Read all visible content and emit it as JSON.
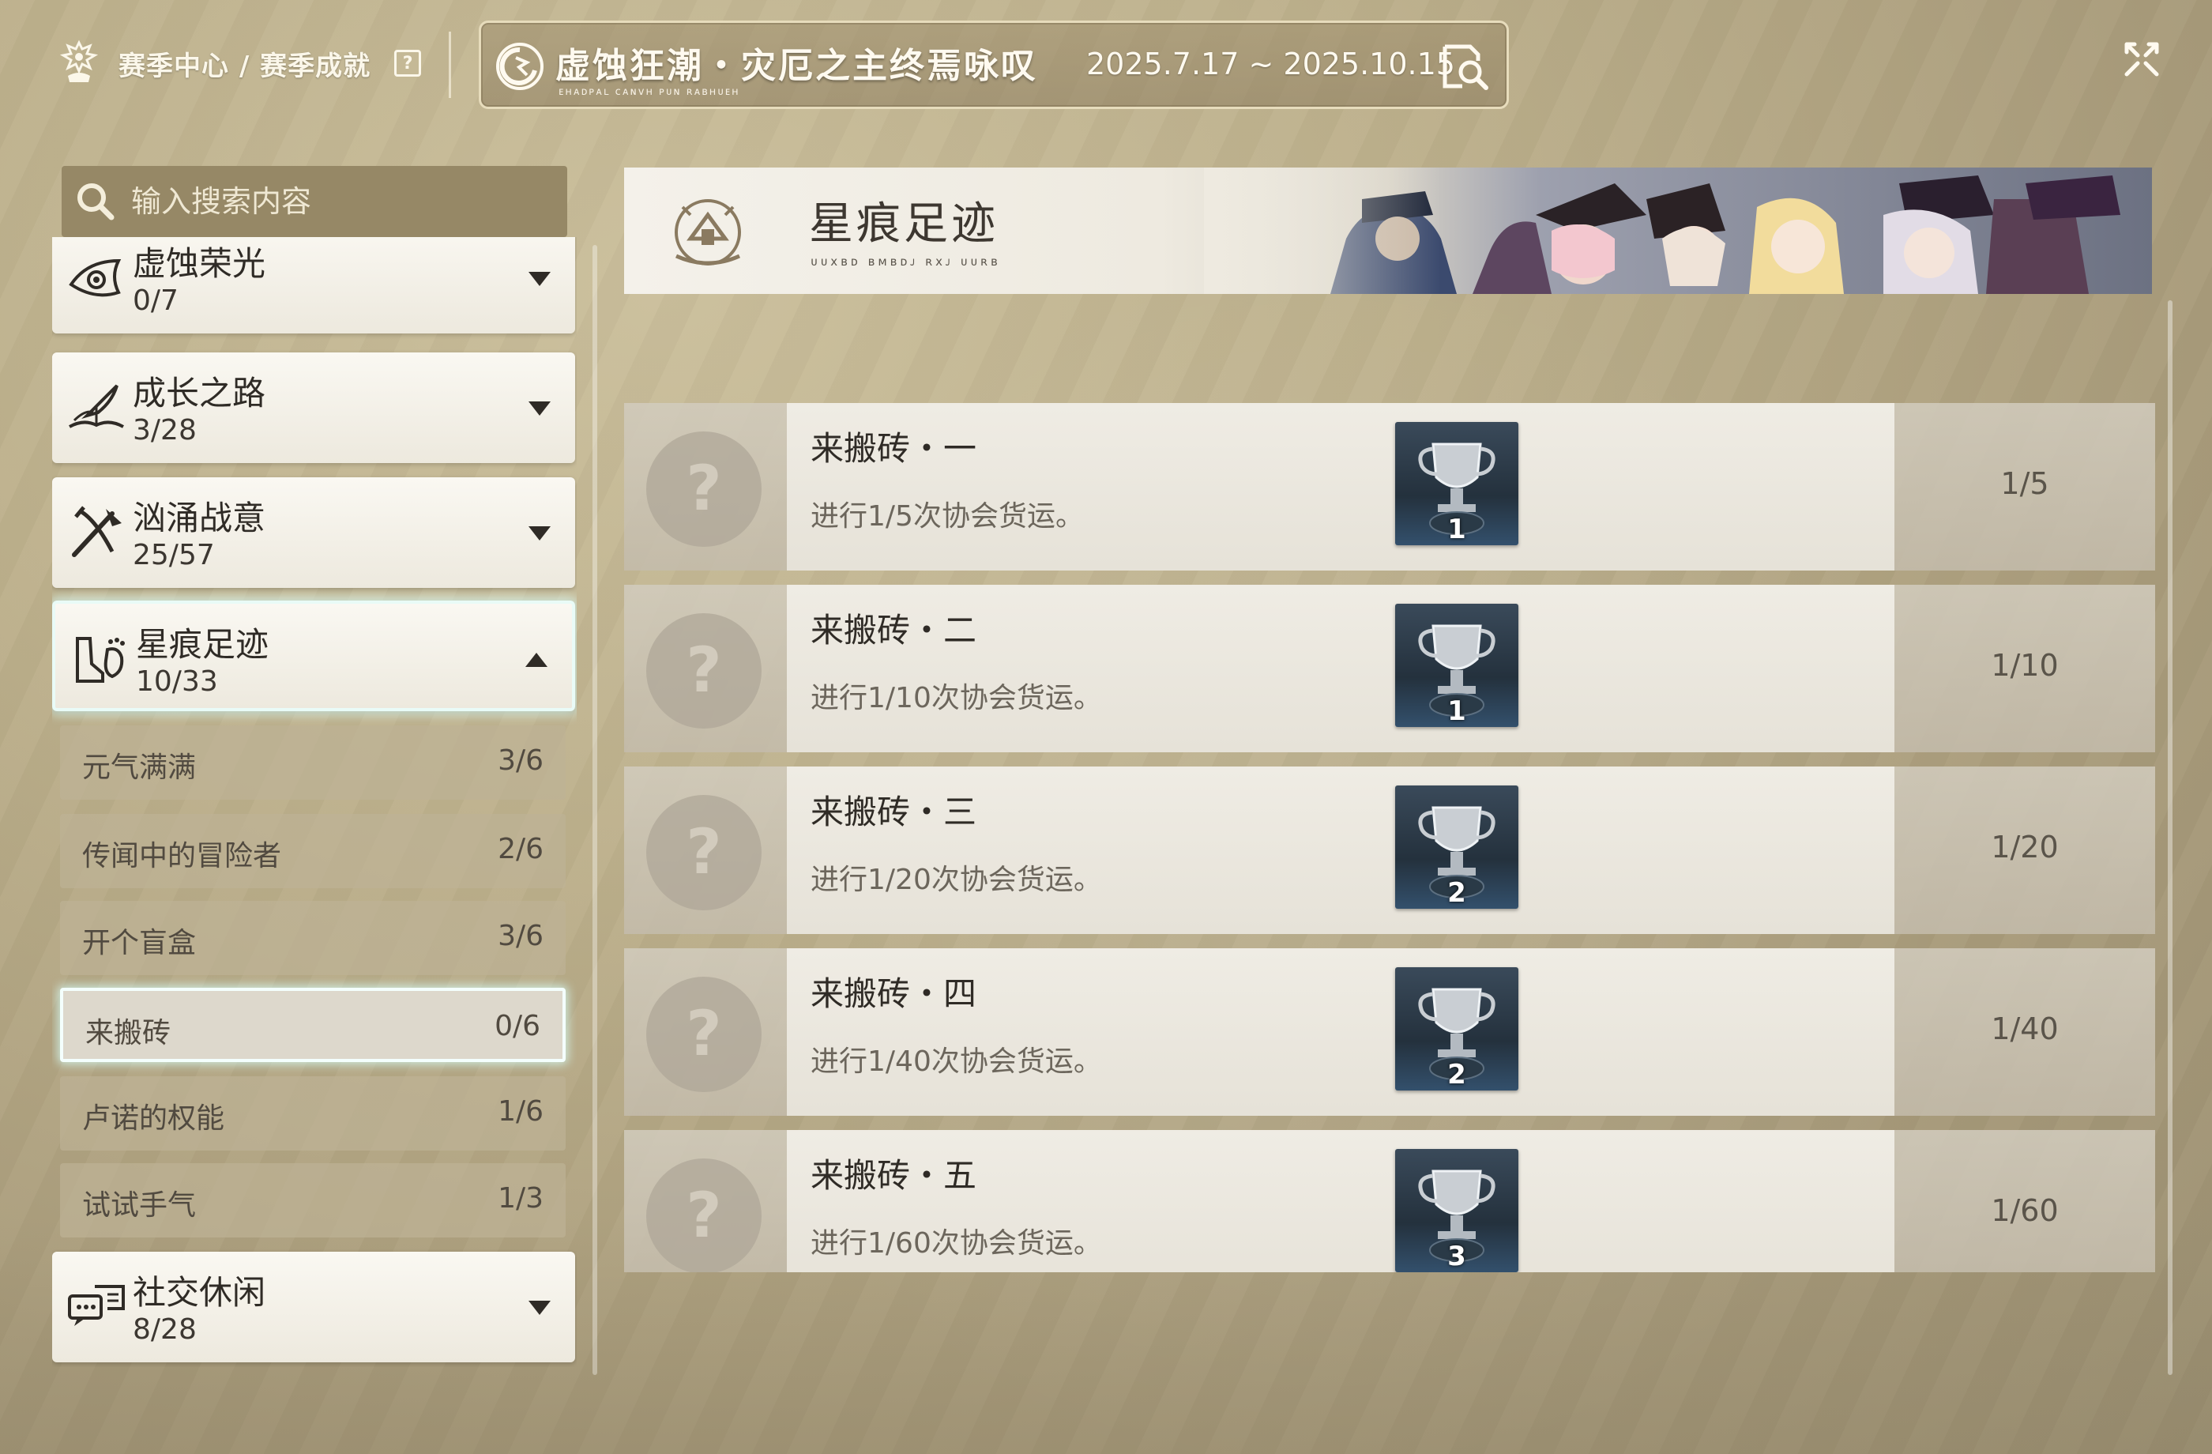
{
  "breadcrumb": {
    "text": "赛季中心 / 赛季成就",
    "help": "?"
  },
  "season": {
    "title": "虚蚀狂潮・灾厄之主终焉咏叹",
    "subtitle": "ᴇʜᴀᴅᴘᴀʟ ᴄᴀɴᴠʜ ᴘᴜɴ ʀᴀʙʜᴜᴇʜ",
    "dates": "2025.7.17 ~ 2025.10.15"
  },
  "search": {
    "placeholder": "输入搜索内容"
  },
  "categories": [
    {
      "name": "虚蚀荣光",
      "count": "0/7",
      "icon": "eye-swirl-icon",
      "expanded": false
    },
    {
      "name": "成长之路",
      "count": "3/28",
      "icon": "book-quill-icon",
      "expanded": false
    },
    {
      "name": "汹涌战意",
      "count": "25/57",
      "icon": "crossed-weapons-icon",
      "expanded": false
    },
    {
      "name": "星痕足迹",
      "count": "10/33",
      "icon": "boot-footprint-icon",
      "expanded": true
    },
    {
      "name": "社交休闲",
      "count": "8/28",
      "icon": "chat-bubbles-icon",
      "expanded": false
    }
  ],
  "subcategories": [
    {
      "name": "元气满满",
      "count": "3/6"
    },
    {
      "name": "传闻中的冒险者",
      "count": "2/6"
    },
    {
      "name": "开个盲盒",
      "count": "3/6"
    },
    {
      "name": "来搬砖",
      "count": "0/6",
      "selected": true
    },
    {
      "name": "卢诺的权能",
      "count": "1/6"
    },
    {
      "name": "试试手气",
      "count": "1/3"
    }
  ],
  "banner": {
    "title": "星痕足迹",
    "subtitle": "ᴜᴜxʙᴅ ʙᴍʙᴅᴊ ʀxᴊ ᴜᴜʀʙ"
  },
  "achievements": [
    {
      "status": "?",
      "title": "来搬砖・一",
      "desc": "进行1/5次协会货运。",
      "trophy_level": "1",
      "progress": "1/5"
    },
    {
      "status": "?",
      "title": "来搬砖・二",
      "desc": "进行1/10次协会货运。",
      "trophy_level": "1",
      "progress": "1/10"
    },
    {
      "status": "?",
      "title": "来搬砖・三",
      "desc": "进行1/20次协会货运。",
      "trophy_level": "2",
      "progress": "1/20"
    },
    {
      "status": "?",
      "title": "来搬砖・四",
      "desc": "进行1/40次协会货运。",
      "trophy_level": "2",
      "progress": "1/40"
    },
    {
      "status": "?",
      "title": "来搬砖・五",
      "desc": "进行1/60次协会货运。",
      "trophy_level": "3",
      "progress": "1/60"
    }
  ],
  "colors": {
    "accent_glow": "#e9fbf7",
    "card": "#faf8f2",
    "search_bg": "#968866"
  }
}
